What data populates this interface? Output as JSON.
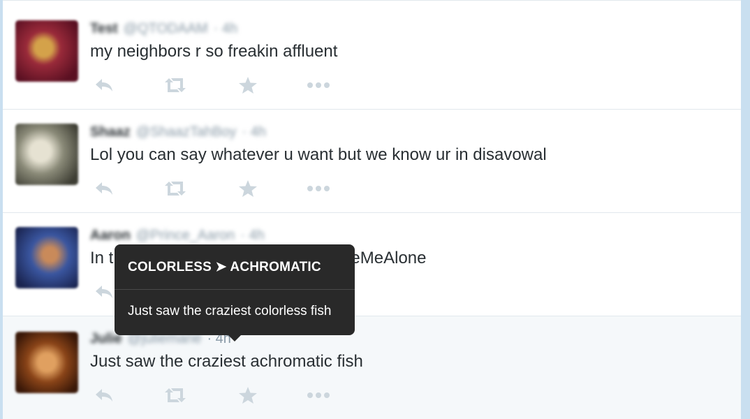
{
  "tweets": [
    {
      "name": "Test",
      "handle": "@QTODAAM",
      "time": "· 4h",
      "text": "my neighbors r so freakin affluent",
      "avatar_color": "#7a1a2a",
      "avatar_accent": "#d4a24a"
    },
    {
      "name": "Shaaz",
      "handle": "@ShaazTahBoy",
      "time": "· 4h",
      "text": "Lol you can say whatever u want but we know ur in disavowal",
      "avatar_color": "#6b6a5a",
      "avatar_accent": "#d8d6c8"
    },
    {
      "name": "Aaron",
      "handle": "@Prince_Aaron",
      "time": "· 4h",
      "text": "In t                                                   eMeAlone",
      "avatar_color": "#243a7a",
      "avatar_accent": "#c98a5a"
    },
    {
      "name": "Julie",
      "handle": "@juliemarie",
      "time": "· 4h",
      "text": "Just saw the craziest achromatic fish",
      "avatar_color": "#6a3010",
      "avatar_accent": "#e0a060"
    }
  ],
  "actions": [
    "reply-icon",
    "retweet-icon",
    "favorite-icon",
    "more-icon"
  ],
  "tooltip": {
    "title": "COLORLESS ➤ ACHROMATIC",
    "body": "Just saw the craziest colorless fish"
  },
  "colors": {
    "accent_border": "#c9dff0",
    "text": "#292f33",
    "muted": "#8899a6",
    "action_icon": "#ccd6dd",
    "tooltip_bg": "#292929"
  }
}
